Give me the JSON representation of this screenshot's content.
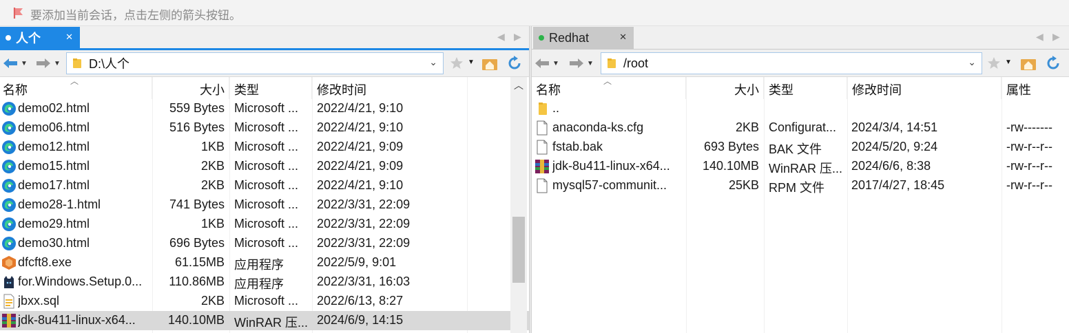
{
  "hint": {
    "text": "要添加当前会话，点击左侧的箭头按钮。"
  },
  "left": {
    "tab": {
      "label": "人个"
    },
    "address": "D:\\人个",
    "columns": {
      "name": "名称",
      "size": "大小",
      "type": "类型",
      "modified": "修改时间"
    },
    "files": [
      {
        "icon": "edge-html-icon",
        "name": "demo02.html",
        "size": "559 Bytes",
        "type": "Microsoft ...",
        "modified": "2022/4/21, 9:10"
      },
      {
        "icon": "edge-html-icon",
        "name": "demo06.html",
        "size": "516 Bytes",
        "type": "Microsoft ...",
        "modified": "2022/4/21, 9:10"
      },
      {
        "icon": "edge-html-icon",
        "name": "demo12.html",
        "size": "1KB",
        "type": "Microsoft ...",
        "modified": "2022/4/21, 9:09"
      },
      {
        "icon": "edge-html-icon",
        "name": "demo15.html",
        "size": "2KB",
        "type": "Microsoft ...",
        "modified": "2022/4/21, 9:09"
      },
      {
        "icon": "edge-html-icon",
        "name": "demo17.html",
        "size": "2KB",
        "type": "Microsoft ...",
        "modified": "2022/4/21, 9:10"
      },
      {
        "icon": "edge-html-icon",
        "name": "demo28-1.html",
        "size": "741 Bytes",
        "type": "Microsoft ...",
        "modified": "2022/3/31, 22:09"
      },
      {
        "icon": "edge-html-icon",
        "name": "demo29.html",
        "size": "1KB",
        "type": "Microsoft ...",
        "modified": "2022/3/31, 22:09"
      },
      {
        "icon": "edge-html-icon",
        "name": "demo30.html",
        "size": "696 Bytes",
        "type": "Microsoft ...",
        "modified": "2022/3/31, 22:09"
      },
      {
        "icon": "installer-icon",
        "name": "dfcft8.exe",
        "size": "61.15MB",
        "type": "应用程序",
        "modified": "2022/5/9, 9:01"
      },
      {
        "icon": "cat-app-icon",
        "name": "for.Windows.Setup.0...",
        "size": "110.86MB",
        "type": "应用程序",
        "modified": "2022/3/31, 16:03"
      },
      {
        "icon": "sql-file-icon",
        "name": "jbxx.sql",
        "size": "2KB",
        "type": "Microsoft ...",
        "modified": "2022/6/13, 8:27"
      },
      {
        "icon": "winrar-icon",
        "name": "jdk-8u411-linux-x64...",
        "size": "140.10MB",
        "type": "WinRAR 压...",
        "modified": "2024/6/9, 14:15",
        "selected": true
      }
    ]
  },
  "right": {
    "tab": {
      "label": "Redhat"
    },
    "address": "/root",
    "columns": {
      "name": "名称",
      "size": "大小",
      "type": "类型",
      "modified": "修改时间",
      "attr": "属性"
    },
    "files": [
      {
        "icon": "folder-icon",
        "name": "..",
        "size": "",
        "type": "",
        "modified": "",
        "attr": ""
      },
      {
        "icon": "file-icon",
        "name": "anaconda-ks.cfg",
        "size": "2KB",
        "type": "Configurat...",
        "modified": "2024/3/4, 14:51",
        "attr": "-rw-------"
      },
      {
        "icon": "file-icon",
        "name": "fstab.bak",
        "size": "693 Bytes",
        "type": "BAK 文件",
        "modified": "2024/5/20, 9:24",
        "attr": "-rw-r--r--"
      },
      {
        "icon": "winrar-icon",
        "name": "jdk-8u411-linux-x64...",
        "size": "140.10MB",
        "type": "WinRAR 压...",
        "modified": "2024/6/6, 8:38",
        "attr": "-rw-r--r--"
      },
      {
        "icon": "file-icon",
        "name": "mysql57-communit...",
        "size": "25KB",
        "type": "RPM 文件",
        "modified": "2017/4/27, 18:45",
        "attr": "-rw-r--r--"
      }
    ]
  }
}
